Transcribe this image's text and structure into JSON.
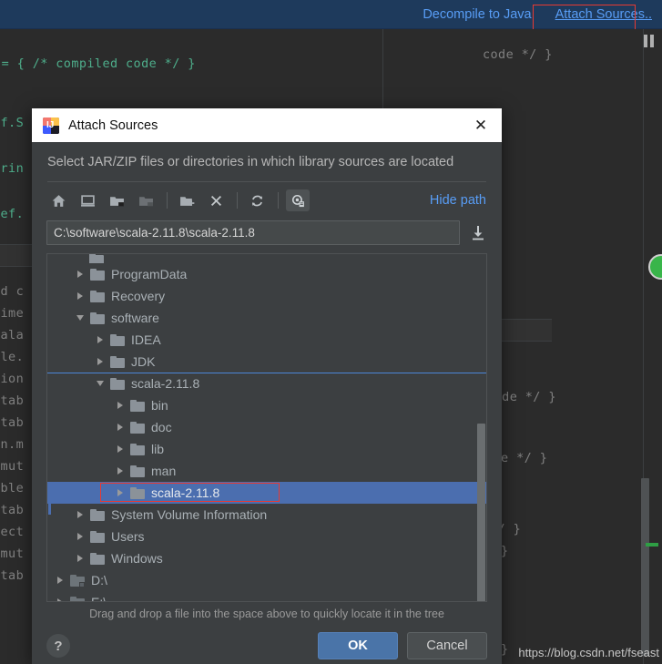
{
  "ide": {
    "notification": {
      "decompile_label": "Decompile to Java",
      "attach_sources_label": "Attach Sources..",
      "accent_color": "#589df6",
      "bar_color": "#1e3a5c",
      "highlight_box_color": "#e83a32"
    },
    "pause_icon": "pause-icon",
    "status_circle_color": "#39b54a",
    "watermark": "https://blog.csdn.net/fseast",
    "code_lines_left": [
      "ef.S",
      "trin",
      "def.",
      "ed c",
      "time",
      "cala",
      "ble.",
      "tion",
      "utab",
      "utab",
      "on.m",
      ".mut",
      "able",
      "utab",
      "lect",
      ".mut",
      "utab"
    ],
    "code_lines_top": [
      "ce = { /* compiled code */ }"
    ],
    "code_lines_right": [
      "code */ }",
      "led code */ }",
      "ode */ }",
      "*/ }",
      "}",
      "}"
    ]
  },
  "dialog": {
    "title": "Attach Sources",
    "app_icon": "intellij-idea-icon",
    "close_icon": "close-icon",
    "subtitle": "Select JAR/ZIP files or directories in which library sources are located",
    "hide_path_label": "Hide path",
    "toolbar": [
      {
        "name": "home-icon",
        "label": "Home",
        "state": "normal"
      },
      {
        "name": "desktop-icon",
        "label": "Desktop",
        "state": "normal"
      },
      {
        "name": "project-folder-icon",
        "label": "Project",
        "state": "normal"
      },
      {
        "name": "module-folder-icon",
        "label": "Module",
        "state": "disabled"
      },
      {
        "name": "new-folder-icon",
        "label": "New Folder",
        "state": "normal"
      },
      {
        "name": "delete-icon",
        "label": "Delete",
        "state": "normal"
      },
      {
        "name": "refresh-icon",
        "label": "Refresh",
        "state": "normal"
      },
      {
        "name": "show-hidden-files-icon",
        "label": "Show Hidden Files",
        "state": "selected"
      }
    ],
    "path": {
      "value": "C:\\software\\scala-2.11.8\\scala-2.11.8",
      "placeholder": "Path",
      "download_icon": "download-icon"
    },
    "tree": {
      "partial_top_row": true,
      "items": [
        {
          "label": "ProgramData",
          "depth": 1,
          "expander": "closed",
          "icon": "folder-icon",
          "selected": false
        },
        {
          "label": "Recovery",
          "depth": 1,
          "expander": "closed",
          "icon": "folder-icon",
          "selected": false
        },
        {
          "label": "software",
          "depth": 1,
          "expander": "open",
          "icon": "folder-icon",
          "selected": false
        },
        {
          "label": "IDEA",
          "depth": 2,
          "expander": "closed",
          "icon": "folder-icon",
          "selected": false
        },
        {
          "label": "JDK",
          "depth": 2,
          "expander": "closed",
          "icon": "folder-icon",
          "selected": false
        },
        {
          "label": "scala-2.11.8",
          "depth": 2,
          "expander": "open",
          "icon": "folder-icon",
          "selected": false
        },
        {
          "label": "bin",
          "depth": 3,
          "expander": "closed",
          "icon": "folder-icon",
          "selected": false
        },
        {
          "label": "doc",
          "depth": 3,
          "expander": "closed",
          "icon": "folder-icon",
          "selected": false
        },
        {
          "label": "lib",
          "depth": 3,
          "expander": "closed",
          "icon": "folder-icon",
          "selected": false
        },
        {
          "label": "man",
          "depth": 3,
          "expander": "closed",
          "icon": "folder-icon",
          "selected": false
        },
        {
          "label": "scala-2.11.8",
          "depth": 3,
          "expander": "closed",
          "icon": "folder-icon",
          "selected": true
        },
        {
          "label": "System Volume Information",
          "depth": 1,
          "expander": "closed",
          "icon": "folder-icon",
          "selected": false
        },
        {
          "label": "Users",
          "depth": 1,
          "expander": "closed",
          "icon": "folder-icon",
          "selected": false
        },
        {
          "label": "Windows",
          "depth": 1,
          "expander": "closed",
          "icon": "folder-icon",
          "selected": false
        },
        {
          "label": "D:\\",
          "depth": 0,
          "expander": "closed",
          "icon": "drive-locked-icon",
          "selected": false
        },
        {
          "label": "E:\\",
          "depth": 0,
          "expander": "closed",
          "icon": "drive-locked-icon",
          "selected": false
        }
      ],
      "selection_color": "#4b6eaf",
      "drop_indicator_color": "#4b86d8"
    },
    "drag_hint": "Drag and drop a file into the space above to quickly locate it in the tree",
    "help_label": "?",
    "ok_label": "OK",
    "cancel_label": "Cancel"
  }
}
